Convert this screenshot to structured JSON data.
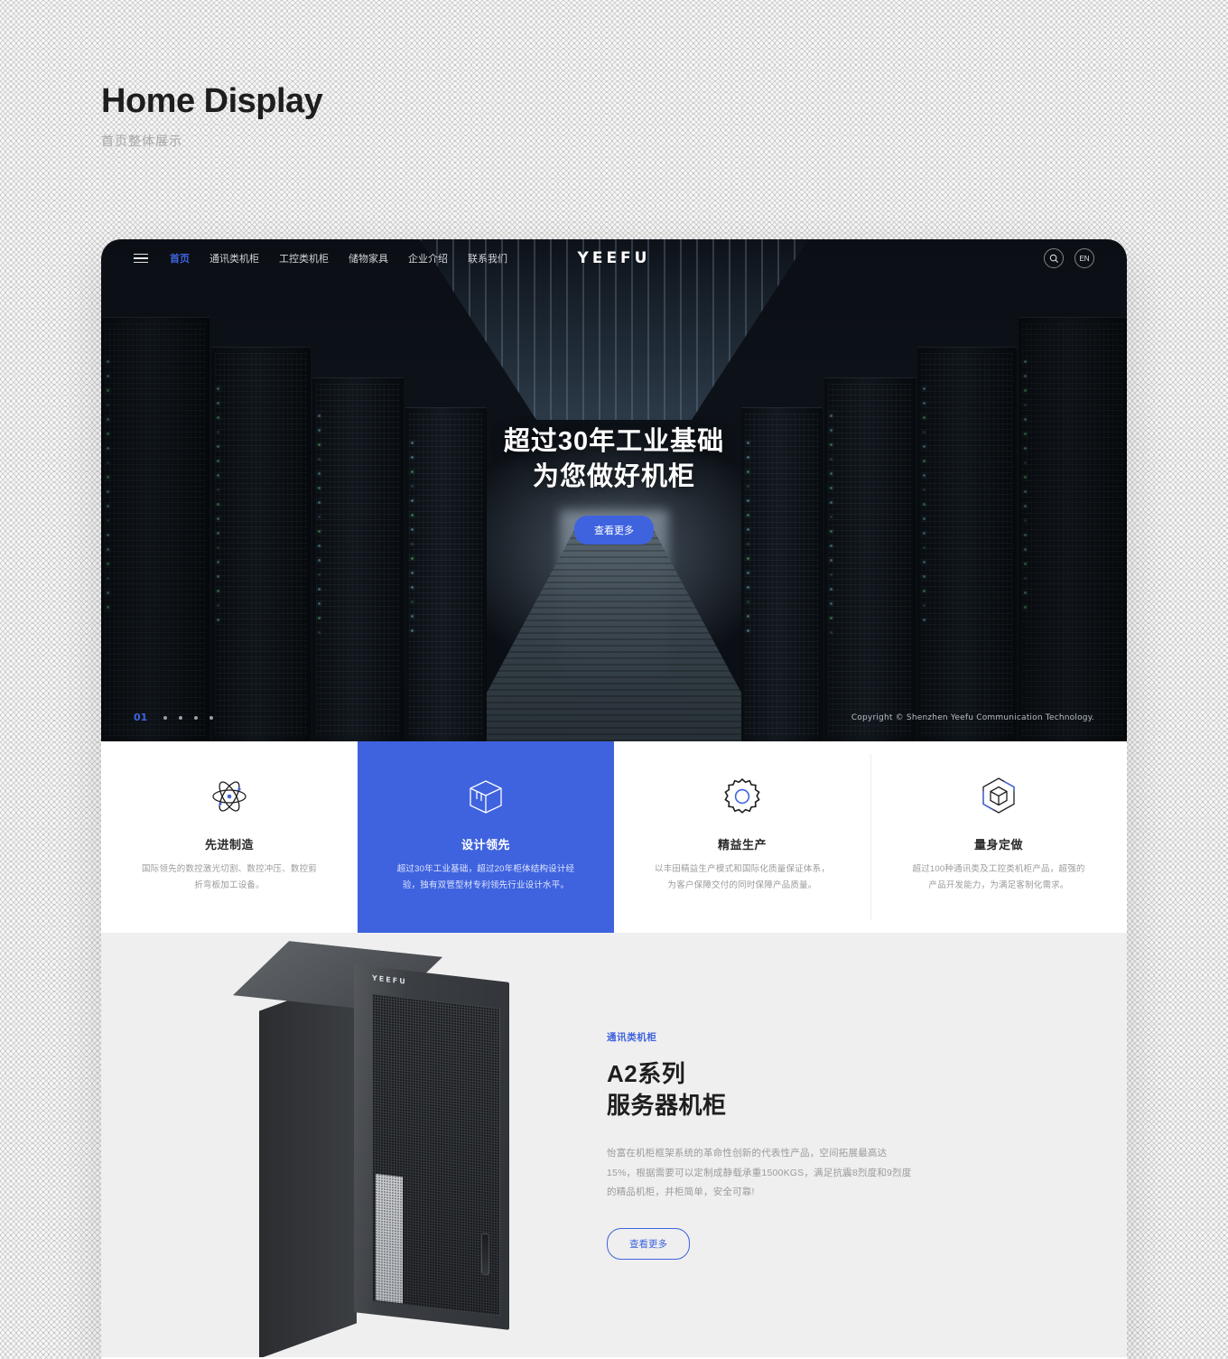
{
  "page": {
    "title": "Home Display",
    "subtitle": "首页整体展示"
  },
  "colors": {
    "accent": "#3f63df",
    "dark": "#0b0f15",
    "section_bg": "#efefef"
  },
  "nav": {
    "menu_icon": "hamburger-icon",
    "brand": "YEEFU",
    "items": [
      {
        "label": "首页",
        "active": true
      },
      {
        "label": "通讯类机柜",
        "active": false
      },
      {
        "label": "工控类机柜",
        "active": false
      },
      {
        "label": "储物家具",
        "active": false
      },
      {
        "label": "企业介绍",
        "active": false
      },
      {
        "label": "联系我们",
        "active": false
      }
    ],
    "search_icon": "search-icon",
    "language": "EN"
  },
  "hero": {
    "headline_line1": "超过30年工业基础",
    "headline_line2": "为您做好机柜",
    "cta": "查看更多",
    "slide_number": "01",
    "dots": 4,
    "copyright": "Copyright © Shenzhen Yeefu Communication Technology."
  },
  "features": [
    {
      "icon": "atom-icon",
      "title": "先进制造",
      "desc": "国际领先的数控激光切割、数控冲压、数控剪折弯板加工设备。",
      "active": false
    },
    {
      "icon": "cube-box-icon",
      "title": "设计领先",
      "desc": "超过30年工业基础，超过20年柜体结构设计经验，独有双管型材专利领先行业设计水平。",
      "active": true
    },
    {
      "icon": "gear-icon",
      "title": "精益生产",
      "desc": "以丰田精益生产模式和国际化质量保证体系，为客户保障交付的同时保障产品质量。",
      "active": false
    },
    {
      "icon": "hexagon-cube-icon",
      "title": "量身定做",
      "desc": "超过100种通讯类及工控类机柜产品，超强的产品开发能力，为满足客制化需求。",
      "active": false
    }
  ],
  "product": {
    "tag": "通讯类机柜",
    "title_line1": "A2系列",
    "title_line2": "服务器机柜",
    "desc": "怡富在机柜框架系统的革命性创新的代表性产品，空间拓展最高达15%，根据需要可以定制成静载承重1500KGS，满足抗震8烈度和9烈度的精品机柜，并柜简单，安全可靠!",
    "cta": "查看更多",
    "image_logo": "YEEFU"
  }
}
